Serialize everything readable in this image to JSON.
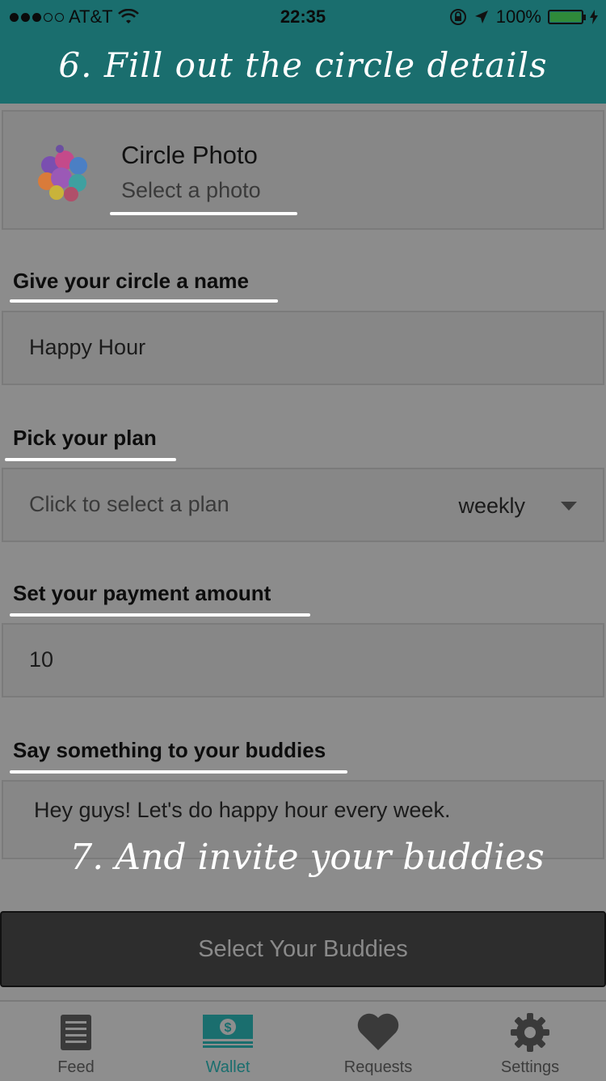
{
  "status_bar": {
    "carrier": "AT&T",
    "time": "22:35",
    "battery": "100%"
  },
  "header": {
    "title": "6. Fill out the circle details"
  },
  "circle_photo": {
    "title": "Circle Photo",
    "subtitle": "Select a photo"
  },
  "name_section": {
    "label": "Give your circle a name",
    "value": "Happy Hour"
  },
  "plan_section": {
    "label": "Pick your plan",
    "placeholder": "Click to select a plan",
    "selected": "weekly"
  },
  "amount_section": {
    "label": "Set your payment amount",
    "value": "10"
  },
  "message_section": {
    "label": "Say something to your buddies",
    "value": "Hey guys! Let's do happy hour every week."
  },
  "annotation": "7. And invite your buddies",
  "cta_button": "Select Your Buddies",
  "tabs": [
    {
      "label": "Feed",
      "icon": "feed-icon"
    },
    {
      "label": "Wallet",
      "icon": "wallet-icon"
    },
    {
      "label": "Requests",
      "icon": "heart-icon"
    },
    {
      "label": "Settings",
      "icon": "gear-icon"
    }
  ],
  "colors": {
    "header": "#1a6e6e",
    "accent": "#1a6e6e",
    "overlay": "#8c8c8c"
  }
}
